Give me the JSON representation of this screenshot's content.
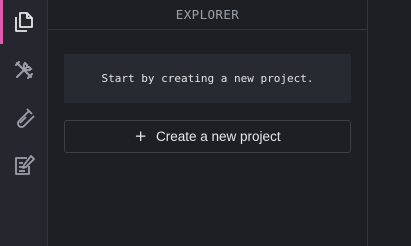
{
  "activity_bar": {
    "items": [
      {
        "icon": "files-icon",
        "active": true
      },
      {
        "icon": "tools-icon",
        "active": false
      },
      {
        "icon": "flask-icon",
        "active": false
      },
      {
        "icon": "edit-document-icon",
        "active": false
      }
    ]
  },
  "explorer": {
    "title": "EXPLORER",
    "notice": "Start by creating a new project.",
    "create_button": {
      "icon": "+",
      "label": "Create a new project"
    }
  },
  "colors": {
    "accent": "#e05dab",
    "sidebar_bg": "#26272e",
    "panel_bg": "#1e1f24",
    "notice_bg": "#282a31",
    "border": "#3e4048"
  }
}
